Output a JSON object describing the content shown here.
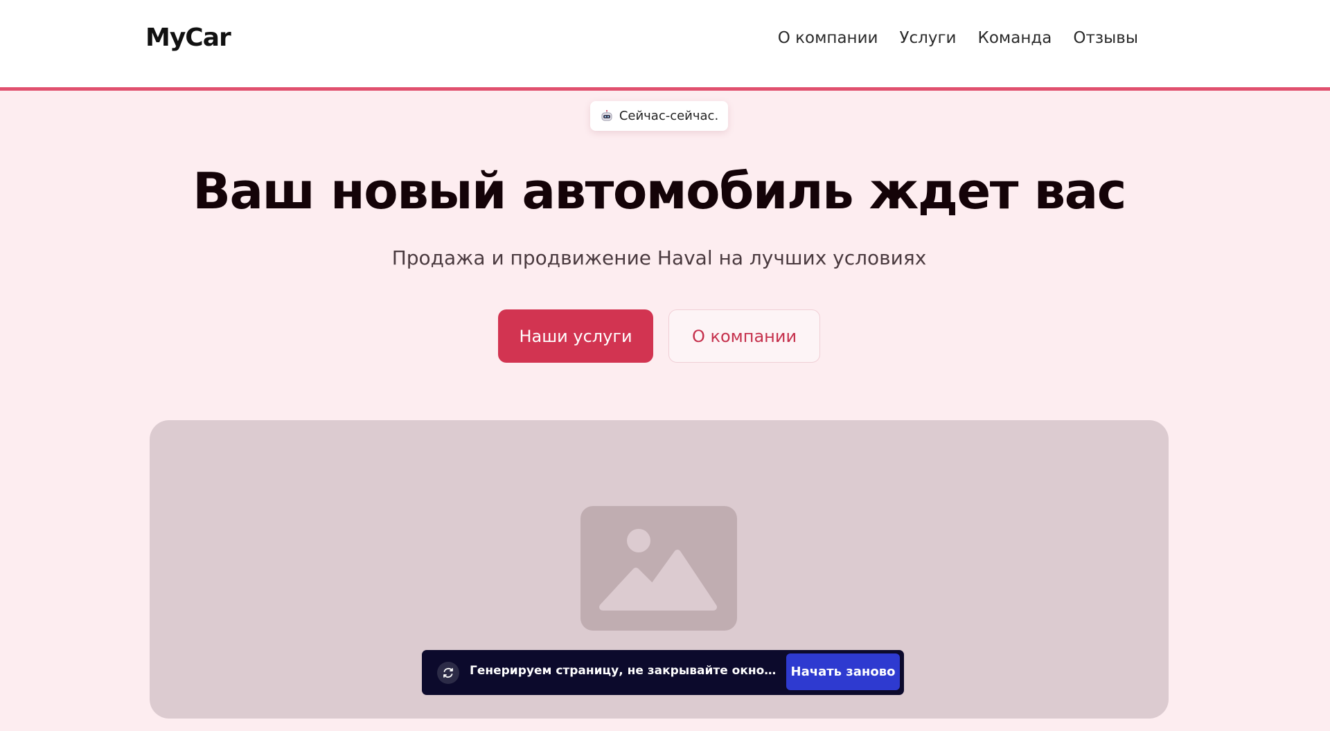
{
  "header": {
    "logo": "MyCar",
    "nav": [
      {
        "label": "О компании"
      },
      {
        "label": "Услуги"
      },
      {
        "label": "Команда"
      },
      {
        "label": "Отзывы"
      }
    ]
  },
  "badge": {
    "icon": "robot-icon",
    "text": "Сейчас-сейчас."
  },
  "hero": {
    "title": "Ваш новый автомобиль ждет вас",
    "subtitle": "Продажа и продвижение Haval на лучших условиях",
    "primary_button": "Наши услуги",
    "secondary_button": "О компании"
  },
  "image_placeholder": {
    "icon": "image-placeholder-icon"
  },
  "toast": {
    "icon": "refresh-icon",
    "text": "Генерируем страницу, не закрывайте окно…",
    "button": "Начать заново"
  },
  "colors": {
    "accent": "#d23451",
    "header_border": "#e0506e",
    "background": "#fdedf0",
    "toast_bg": "#0c0a2c",
    "toast_button": "#2e3ad0"
  }
}
